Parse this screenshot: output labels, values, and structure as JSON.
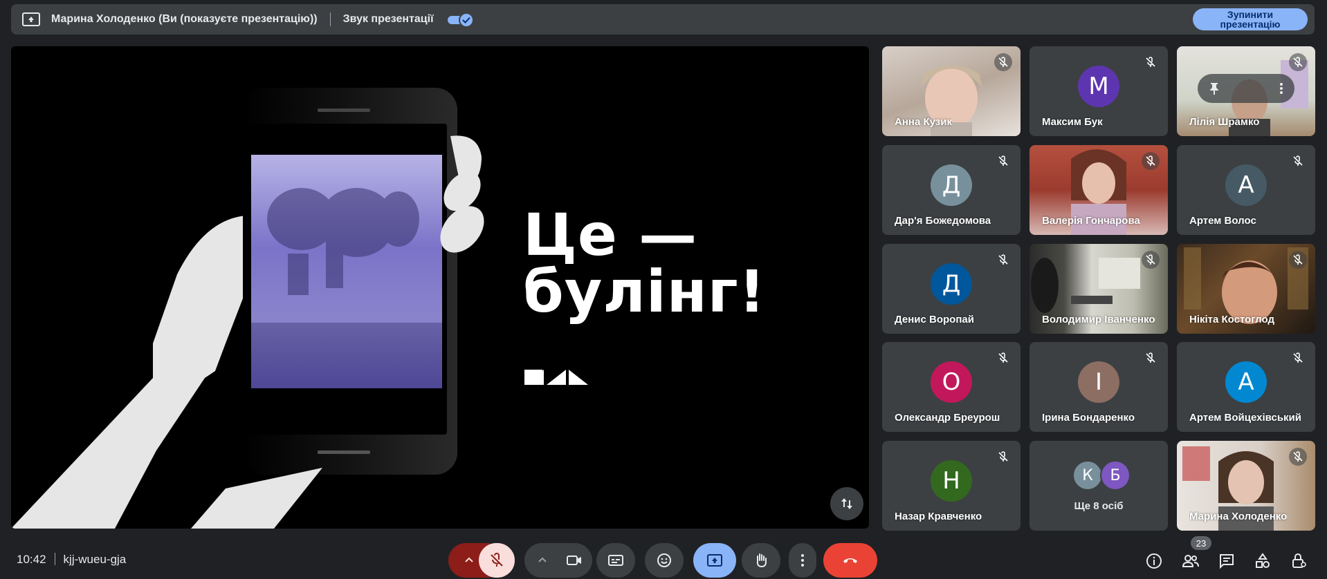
{
  "topbar": {
    "presenter_text": "Марина Холоденко (Ви (показуєте презентацію))",
    "sound_label": "Звук презентації",
    "sound_on": true,
    "stop_button_label": "Зупинити презентацію"
  },
  "slide": {
    "title_line1": "Це —",
    "title_line2": "булінг!"
  },
  "participants": [
    {
      "name": "Анна Кузик",
      "type": "video",
      "muted": true
    },
    {
      "name": "Максим Бук",
      "type": "avatar",
      "initial": "М",
      "color": "#5e35b1",
      "muted": true
    },
    {
      "name": "Лілія Шрамко",
      "type": "video",
      "muted": true,
      "pinned_hover": true
    },
    {
      "name": "Дар'я Божедомова",
      "type": "avatar",
      "initial": "Д",
      "color": "#78909c",
      "muted": true
    },
    {
      "name": "Валерія Гончарова",
      "type": "video",
      "muted": true
    },
    {
      "name": "Артем Волос",
      "type": "avatar",
      "initial": "А",
      "color": "#455a64",
      "muted": true
    },
    {
      "name": "Денис Воропай",
      "type": "avatar",
      "initial": "Д",
      "color": "#01579b",
      "muted": true
    },
    {
      "name": "Володимир Іванченко",
      "type": "video",
      "muted": true
    },
    {
      "name": "Нікіта Костоглод",
      "type": "video",
      "muted": true
    },
    {
      "name": "Олександр Бреурош",
      "type": "avatar",
      "initial": "О",
      "color": "#c2185b",
      "muted": true
    },
    {
      "name": "Ірина Бондаренко",
      "type": "avatar",
      "initial": "І",
      "color": "#8d6e63",
      "muted": true
    },
    {
      "name": "Артем Войцехівський",
      "type": "avatar",
      "initial": "А",
      "color": "#0288d1",
      "muted": true
    },
    {
      "name": "Назар Кравченко",
      "type": "avatar",
      "initial": "Н",
      "color": "#33691e",
      "muted": true
    },
    {
      "name": "Ще 8 осіб",
      "type": "more",
      "initials": [
        "К",
        "Б"
      ],
      "colors": [
        "#78909c",
        "#7e57c2"
      ]
    },
    {
      "name": "Марина Холоденко",
      "type": "video",
      "muted": true
    }
  ],
  "bottombar": {
    "time": "10:42",
    "meeting_code": "kjj-wueu-gja",
    "participant_count": "23"
  },
  "colors": {
    "accent": "#8ab4f8",
    "end_call": "#ea4335",
    "mic_off_bg": "#f9dedc",
    "mic_off_left": "#8c1d18"
  }
}
